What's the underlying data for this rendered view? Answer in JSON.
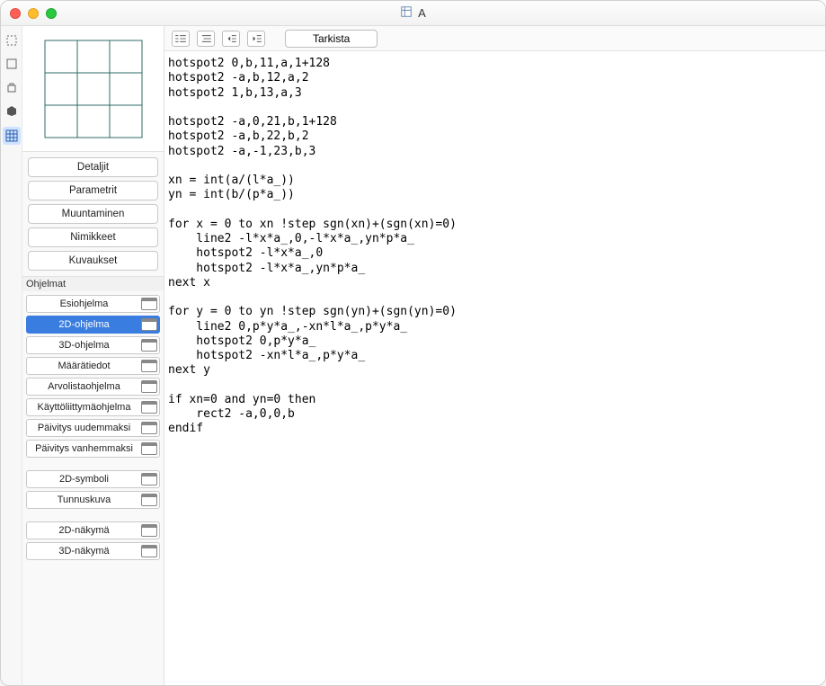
{
  "title": "A",
  "preview_cols": 3,
  "preview_rows": 3,
  "sidebar_buttons": [
    "Detaljit",
    "Parametrit",
    "Muuntaminen",
    "Nimikkeet",
    "Kuvaukset"
  ],
  "scripts_label": "Ohjelmat",
  "scripts": [
    {
      "label": "Esiohjelma",
      "selected": false
    },
    {
      "label": "2D-ohjelma",
      "selected": true
    },
    {
      "label": "3D-ohjelma",
      "selected": false
    },
    {
      "label": "Määrätiedot",
      "selected": false
    },
    {
      "label": "Arvolistaohjelma",
      "selected": false
    },
    {
      "label": "Käyttöliittymäohjelma",
      "selected": false
    },
    {
      "label": "Päivitys uudemmaksi",
      "selected": false
    },
    {
      "label": "Päivitys vanhemmaksi",
      "selected": false
    }
  ],
  "scripts2": [
    {
      "label": "2D-symboli"
    },
    {
      "label": "Tunnuskuva"
    }
  ],
  "scripts3": [
    {
      "label": "2D-näkymä"
    },
    {
      "label": "3D-näkymä"
    }
  ],
  "check_label": "Tarkista",
  "code": "hotspot2 0,b,11,a,1+128\nhotspot2 -a,b,12,a,2\nhotspot2 1,b,13,a,3\n\nhotspot2 -a,0,21,b,1+128\nhotspot2 -a,b,22,b,2\nhotspot2 -a,-1,23,b,3\n\nxn = int(a/(l*a_))\nyn = int(b/(p*a_))\n\nfor x = 0 to xn !step sgn(xn)+(sgn(xn)=0)\n    line2 -l*x*a_,0,-l*x*a_,yn*p*a_\n    hotspot2 -l*x*a_,0\n    hotspot2 -l*x*a_,yn*p*a_\nnext x\n\nfor y = 0 to yn !step sgn(yn)+(sgn(yn)=0)\n    line2 0,p*y*a_,-xn*l*a_,p*y*a_\n    hotspot2 0,p*y*a_\n    hotspot2 -xn*l*a_,p*y*a_\nnext y\n\nif xn=0 and yn=0 then\n    rect2 -a,0,0,b\nendif"
}
